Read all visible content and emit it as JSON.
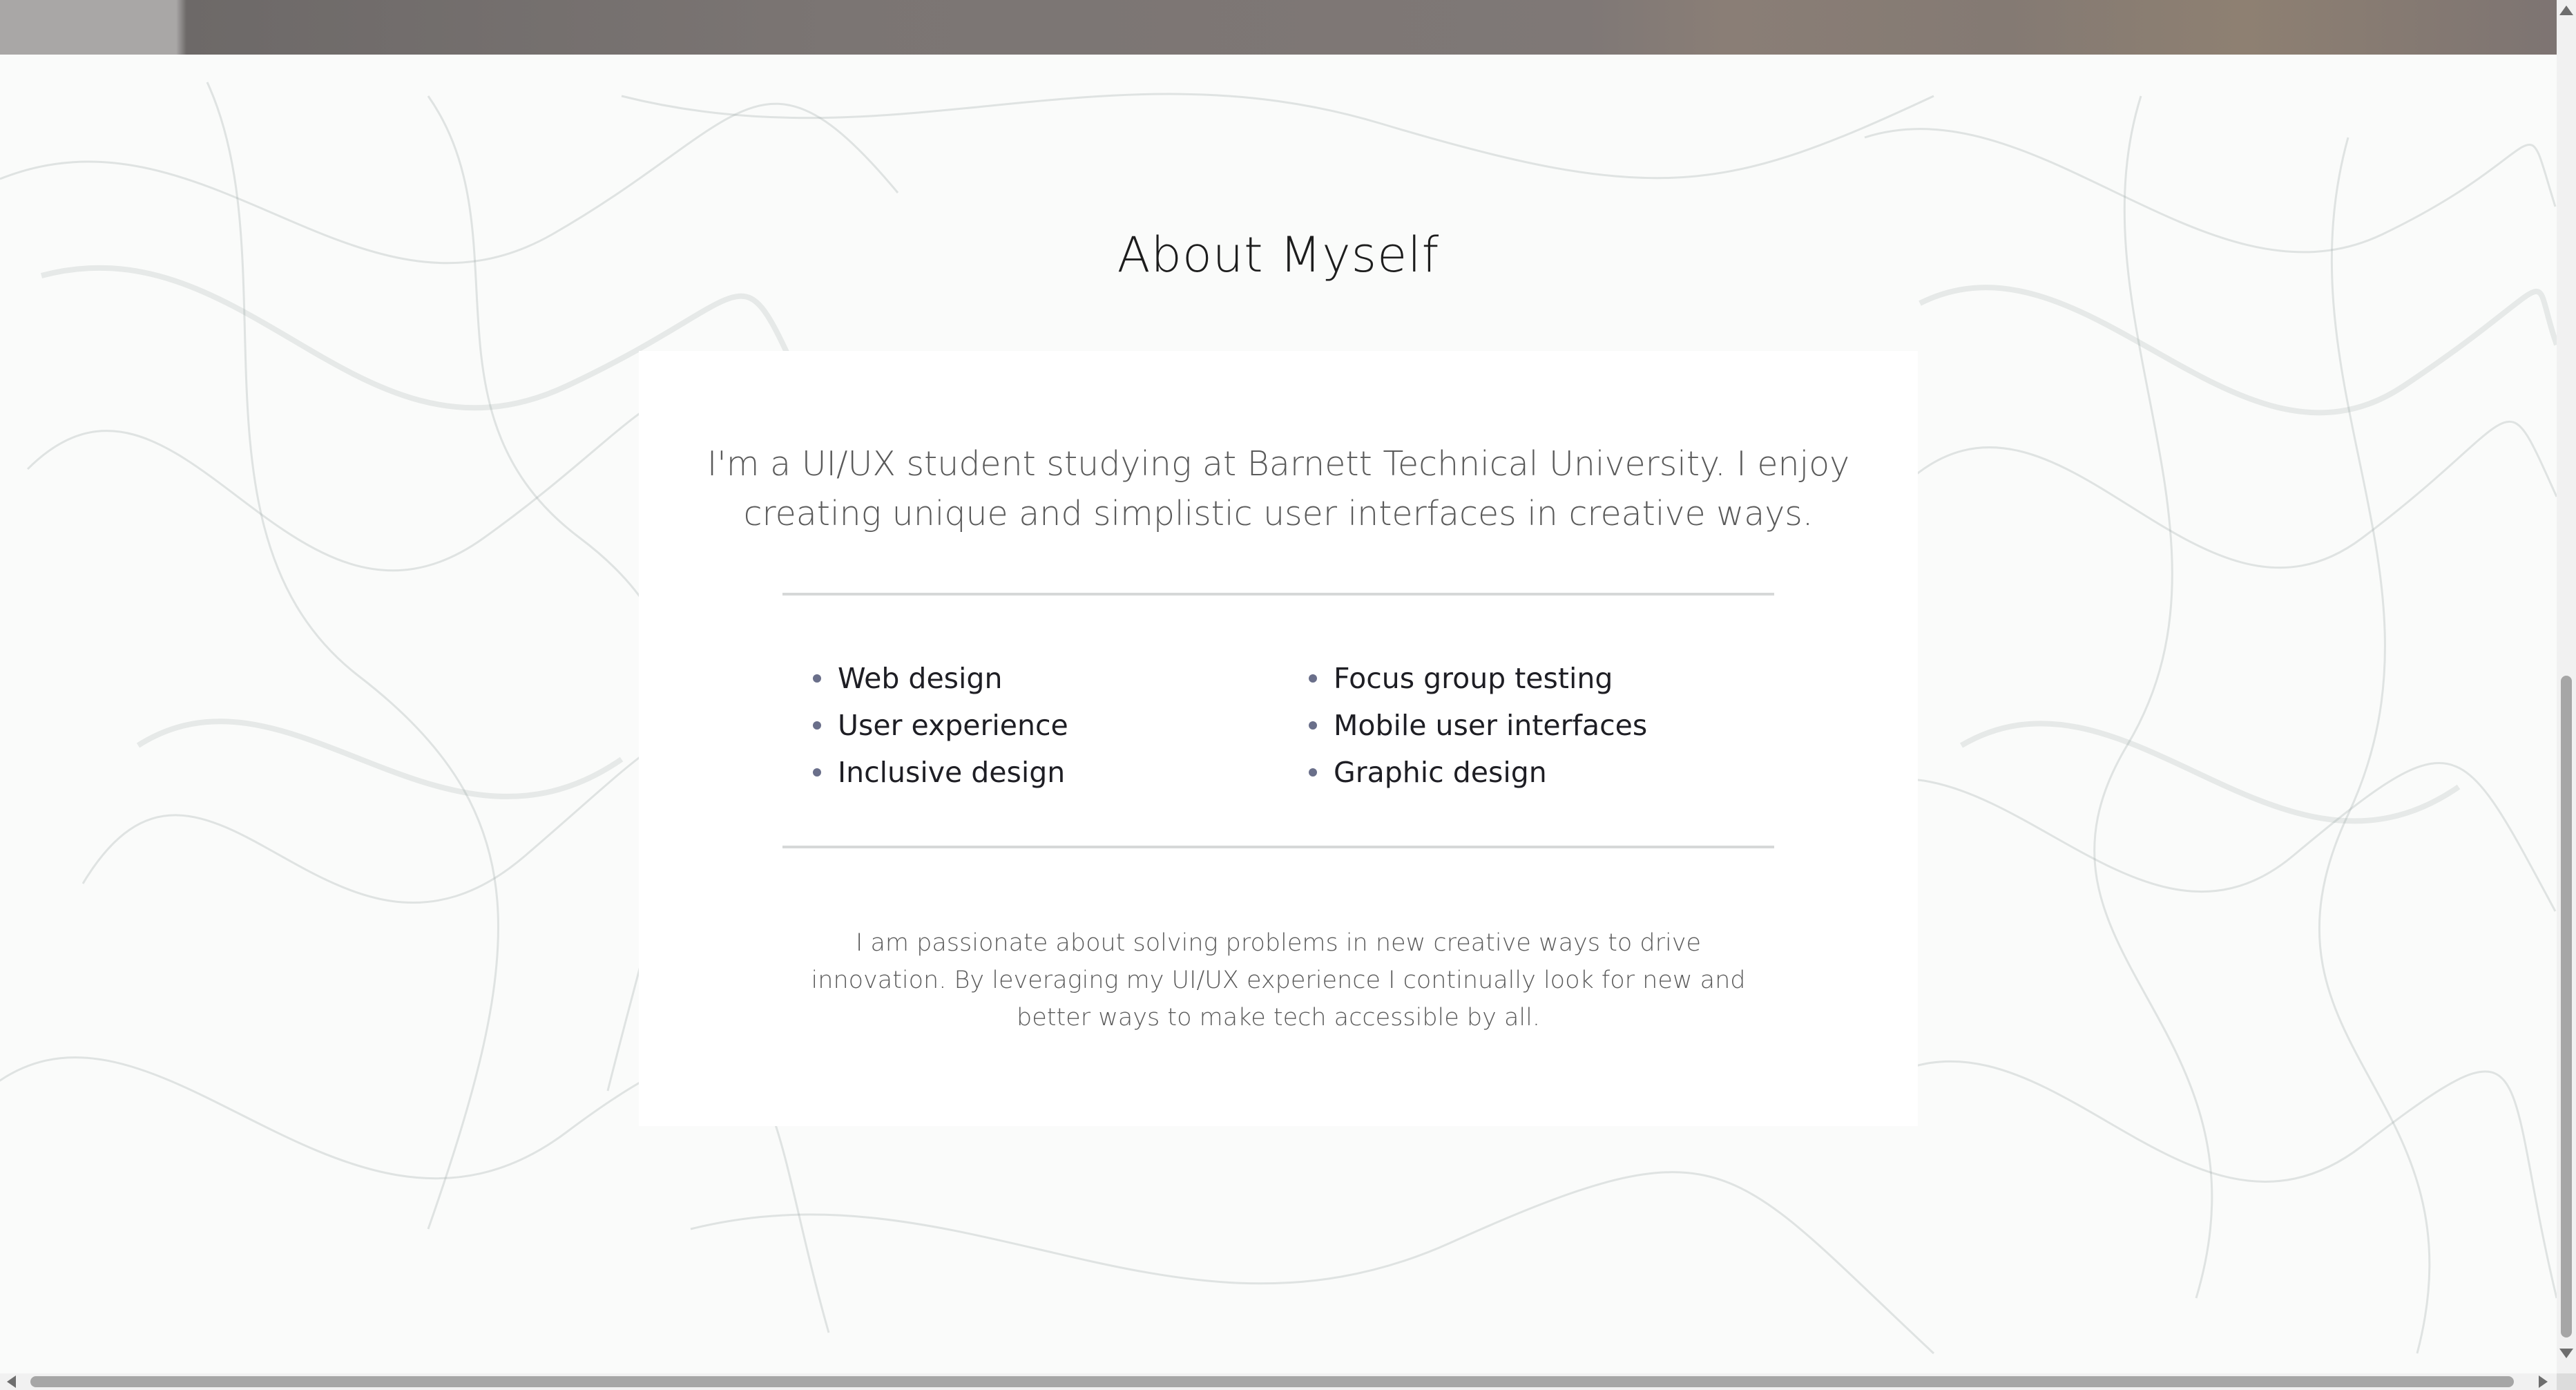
{
  "about": {
    "title": "About Myself",
    "intro": "I'm a UI/UX student studying at Barnett Technical University. I enjoy creating unique and simplistic user interfaces in creative ways.",
    "skills_left": [
      "Web design",
      "User experience",
      "Inclusive design"
    ],
    "skills_right": [
      "Focus group testing",
      "Mobile user interfaces",
      "Graphic design"
    ],
    "passion": "I am passionate about solving problems in new creative ways to drive innovation. By leveraging my UI/UX experience I continually look for new and better ways to make tech accessible by all."
  },
  "colors": {
    "title_text": "#1d1d1d",
    "body_text": "#5a5a5a",
    "skill_text": "#1e1e24",
    "bullet": "#6a6f8a",
    "divider": "#d6d8d8",
    "card_background": "#ffffff",
    "page_background": "#fafbfa",
    "smoke": "#9aa7a4"
  },
  "icons": {
    "bullet": "bullet-dot-icon",
    "scroll_up": "arrow-up-icon",
    "scroll_down": "arrow-down-icon",
    "scroll_left": "arrow-left-icon",
    "scroll_right": "arrow-right-icon"
  }
}
